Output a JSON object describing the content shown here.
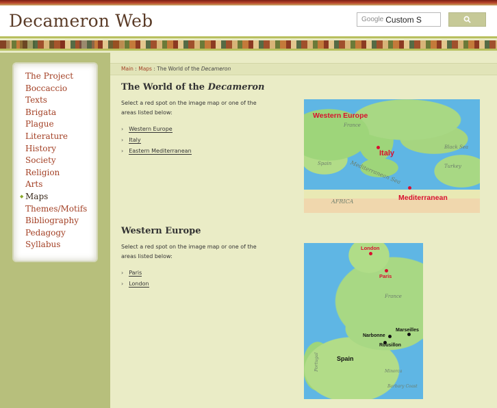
{
  "header": {
    "site_title": "Decameron Web",
    "search_placeholder": "Custom S",
    "search_brand": "Google"
  },
  "nav": {
    "items": [
      {
        "label": "The Project",
        "active": false
      },
      {
        "label": "Boccaccio",
        "active": false
      },
      {
        "label": "Texts",
        "active": false
      },
      {
        "label": "Brigata",
        "active": false
      },
      {
        "label": "Plague",
        "active": false
      },
      {
        "label": "Literature",
        "active": false
      },
      {
        "label": "History",
        "active": false
      },
      {
        "label": "Society",
        "active": false
      },
      {
        "label": "Religion",
        "active": false
      },
      {
        "label": "Arts",
        "active": false
      },
      {
        "label": "Maps",
        "active": true
      },
      {
        "label": "Themes/Motifs",
        "active": false
      },
      {
        "label": "Bibliography",
        "active": false
      },
      {
        "label": "Pedagogy",
        "active": false
      },
      {
        "label": "Syllabus",
        "active": false
      }
    ]
  },
  "breadcrumb": {
    "main": "Main",
    "maps": "Maps",
    "sep": ":",
    "current_prefix": "The World of the",
    "current_italic": "Decameron"
  },
  "section1": {
    "title_prefix": "The World of the ",
    "title_italic": "Decameron",
    "instructions": "Select a red spot on the image map or one of the areas listed below:",
    "links": [
      "Western Europe",
      "Italy",
      "Eastern Mediterranean"
    ],
    "map_labels": {
      "western_europe": "Western Europe",
      "italy": "Italy",
      "mediterranean": "Mediterranean",
      "france": "France",
      "spain": "Spain",
      "mediterranean_sea": "Mediterranean Sea",
      "africa": "AFRICA",
      "black_sea": "Black Sea",
      "turkey": "Turkey"
    }
  },
  "section2": {
    "title": "Western Europe",
    "instructions": "Select a red spot on the image map or one of the areas listed below:",
    "links": [
      "Paris",
      "London"
    ],
    "map_labels": {
      "london": "London",
      "paris": "Paris",
      "france": "France",
      "marseilles": "Marseilles",
      "narbonne": "Narbonne",
      "rousillon": "Rousillon",
      "spain": "Spain",
      "portugal": "Portugal",
      "minorca": "Minorca",
      "barbary_coast": "Barbary Coast"
    }
  },
  "colors": {
    "accent_link": "#a34025",
    "sidebar_bg": "#b7bf7c",
    "content_bg": "#eaecc6",
    "map_red": "#d8102f"
  },
  "icons": {
    "search_button": "search-icon",
    "active_marker": "diamond-marker-icon",
    "list_bullet": "chevron-right-icon"
  }
}
